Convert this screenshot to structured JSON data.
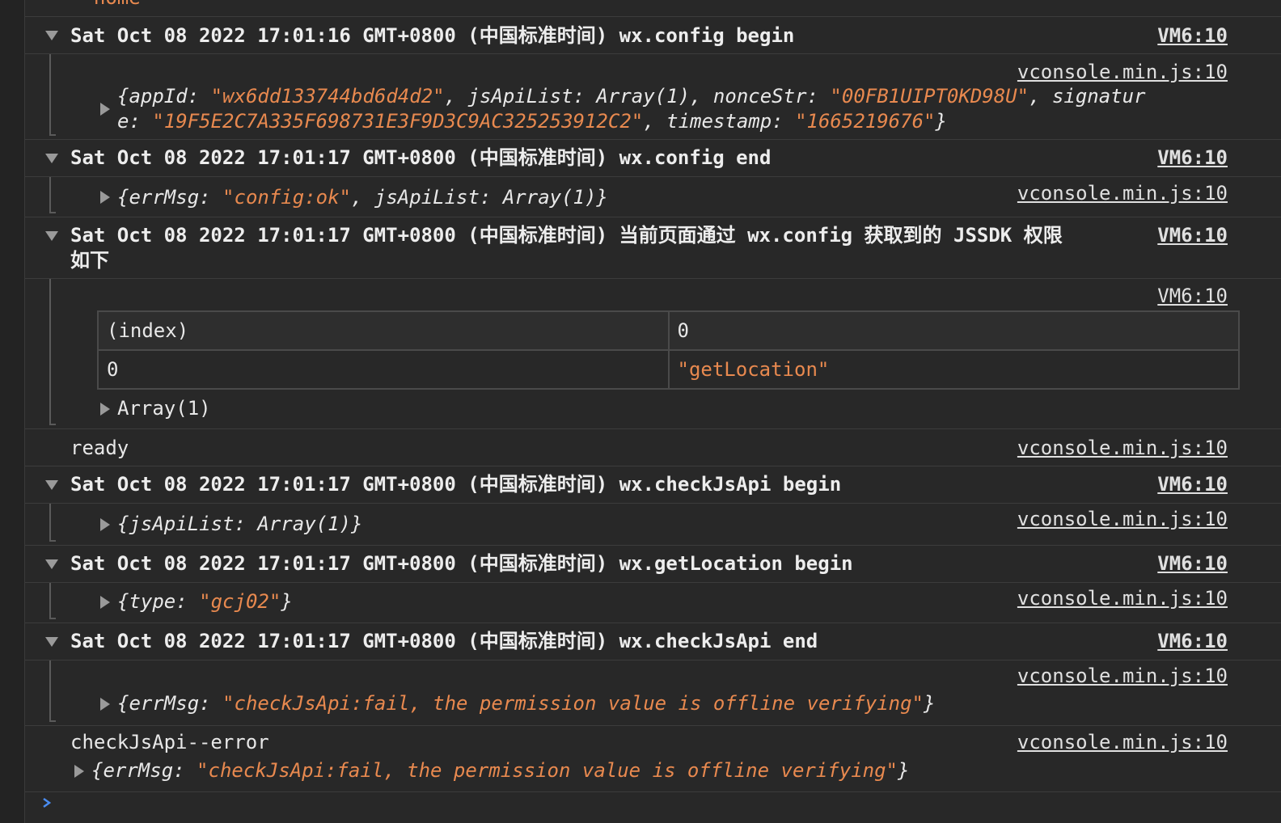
{
  "console": {
    "top_partial": "--home",
    "groups": [
      {
        "header": "Sat Oct 08 2022 17:01:16 GMT+0800 (中国标准时间) wx.config begin",
        "source": "VM6:10",
        "child_source": "vconsole.min.js:10",
        "object": {
          "open": "{",
          "k1": "appId: ",
          "v1": "\"wx6dd133744bd6d4d2\"",
          "k2": ", jsApiList: Array(1), nonceStr: ",
          "v2": "\"00FB1UIPT0KD98U\"",
          "k3": ", signatur",
          "k4": "e: ",
          "v4": "\"19F5E2C7A335F698731E3F9D3C9AC325253912C2\"",
          "k5": ", timestamp: ",
          "v5": "\"1665219676\"",
          "close": "}"
        }
      },
      {
        "header": "Sat Oct 08 2022 17:01:17 GMT+0800 (中国标准时间) wx.config end",
        "source": "VM6:10",
        "child_source": "vconsole.min.js:10",
        "object": {
          "pre": "{errMsg: ",
          "val": "\"config:ok\"",
          "post": ", jsApiList: Array(1)}"
        }
      },
      {
        "header_line1": "Sat Oct 08 2022 17:01:17 GMT+0800 (中国标准时间) 当前页面通过 wx.config 获取到的 JSSDK 权限",
        "header_line2": "如下",
        "source": "VM6:10",
        "child_source": "VM6:10",
        "table": {
          "columns": [
            "(index)",
            "0"
          ],
          "rows": [
            {
              "index": "0",
              "value": "\"getLocation\""
            }
          ]
        },
        "array_label": "Array(1)"
      },
      {
        "plain": "ready",
        "source": "vconsole.min.js:10"
      },
      {
        "header": "Sat Oct 08 2022 17:01:17 GMT+0800 (中国标准时间) wx.checkJsApi begin",
        "source": "VM6:10",
        "child_source": "vconsole.min.js:10",
        "object": {
          "text": "{jsApiList: Array(1)}"
        }
      },
      {
        "header": "Sat Oct 08 2022 17:01:17 GMT+0800 (中国标准时间) wx.getLocation begin",
        "source": "VM6:10",
        "child_source": "vconsole.min.js:10",
        "object": {
          "pre": "{type: ",
          "val": "\"gcj02\"",
          "post": "}"
        }
      },
      {
        "header": "Sat Oct 08 2022 17:01:17 GMT+0800 (中国标准时间) wx.checkJsApi end",
        "source": "VM6:10",
        "child_source": "vconsole.min.js:10",
        "object": {
          "pre": "{errMsg: ",
          "val": "\"checkJsApi:fail, the permission value is offline verifying\"",
          "post": "}"
        }
      },
      {
        "plain": "checkJsApi--error",
        "source": "vconsole.min.js:10",
        "object": {
          "pre": "{errMsg: ",
          "val": "\"checkJsApi:fail, the permission value is offline verifying\"",
          "post": "}"
        }
      }
    ]
  },
  "colors": {
    "background": "#282828",
    "string": "#e8894f",
    "prompt": "#4a8cf0"
  }
}
